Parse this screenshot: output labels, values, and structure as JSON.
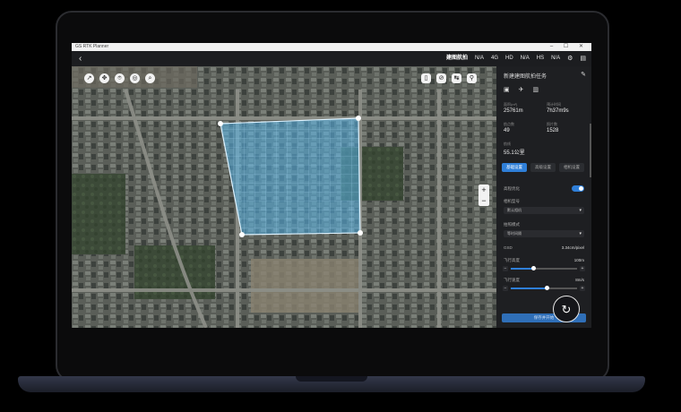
{
  "window": {
    "title": "GS RTK Planner",
    "controls": "–  ☐  ✕"
  },
  "topbar": {
    "mode": "建图航拍",
    "signals": [
      "N/A",
      "4G",
      "HD",
      "N/A",
      "HS",
      "N/A"
    ]
  },
  "map": {
    "left_tools": [
      "↗",
      "✥",
      "⌾",
      "◎",
      "⌕"
    ],
    "right_tools": [
      "▯",
      "⊘",
      "↹",
      "⚲"
    ],
    "zoom_in": "+",
    "zoom_out": "−",
    "area_tag_top": "",
    "area_tag_bottom": "",
    "scale_items": [
      "",
      "",
      "",
      ""
    ]
  },
  "panel": {
    "header": "新建建图航拍任务",
    "stats": [
      {
        "label": "面积(m²)",
        "value": "25761m"
      },
      {
        "label": "预计时间",
        "value": "7h37m9s"
      },
      {
        "label": "航点数",
        "value": "49"
      },
      {
        "label": "照片数",
        "value": "1528"
      },
      {
        "label": "航线",
        "value": "55.1公里"
      }
    ],
    "tabs": [
      "基础设置",
      "高级设置",
      "相机设置"
    ],
    "rows": {
      "obstacle": "高程优化",
      "camera_label": "相机型号",
      "camera_value": "默认相机",
      "mode_label": "拍照模式",
      "mode_value": "等时间隔",
      "gsd_label": "GSD",
      "gsd_value": "3.34cm/pixel",
      "height_label": "飞行高度",
      "height_value": "100m",
      "speed_label": "飞行速度",
      "speed_value": "8m/s"
    },
    "sliders": {
      "height": 0.35,
      "speed": 0.55
    },
    "save_button": "保存并开始"
  },
  "fab_icon": "↻"
}
